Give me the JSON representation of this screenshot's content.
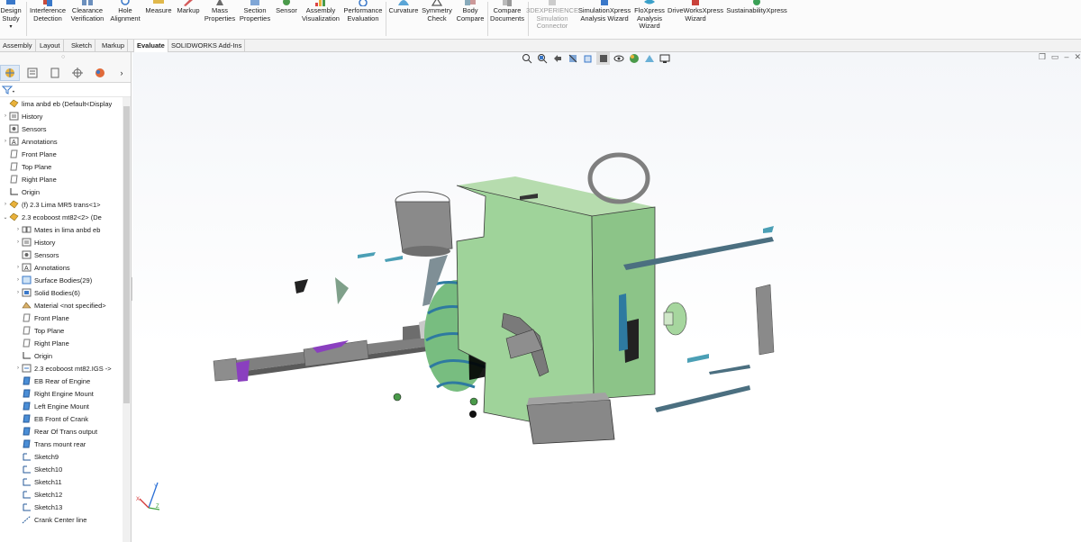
{
  "ribbon": {
    "buttons": [
      {
        "label": "Design\nStudy",
        "icon": "design-study-icon"
      },
      {
        "label": "Interference\nDetection",
        "icon": "interference-detection-icon"
      },
      {
        "label": "Clearance\nVerification",
        "icon": "clearance-verification-icon"
      },
      {
        "label": "Hole\nAlignment",
        "icon": "hole-alignment-icon"
      },
      {
        "label": "Measure",
        "icon": "measure-icon"
      },
      {
        "label": "Markup",
        "icon": "markup-icon"
      },
      {
        "label": "Mass\nProperties",
        "icon": "mass-properties-icon"
      },
      {
        "label": "Section\nProperties",
        "icon": "section-properties-icon"
      },
      {
        "label": "Sensor",
        "icon": "sensor-icon"
      },
      {
        "label": "Assembly\nVisualization",
        "icon": "assembly-visualization-icon"
      },
      {
        "label": "Performance\nEvaluation",
        "icon": "performance-evaluation-icon"
      },
      {
        "label": "Curvature",
        "icon": "curvature-icon"
      },
      {
        "label": "Symmetry\nCheck",
        "icon": "symmetry-check-icon"
      },
      {
        "label": "Body\nCompare",
        "icon": "body-compare-icon"
      },
      {
        "label": "Compare\nDocuments",
        "icon": "compare-documents-icon"
      },
      {
        "label": "3DEXPERIENCE\nSimulation\nConnector",
        "icon": "3dexperience-icon"
      },
      {
        "label": "SimulationXpress\nAnalysis Wizard",
        "icon": "simulationxpress-icon"
      },
      {
        "label": "FloXpress\nAnalysis\nWizard",
        "icon": "floxpress-icon"
      },
      {
        "label": "DriveWorksXpress\nWizard",
        "icon": "driveworksxpress-icon"
      },
      {
        "label": "SustainabilityXpress",
        "icon": "sustainabilityxpress-icon"
      }
    ]
  },
  "tabs": [
    "Assembly",
    "Layout",
    "Sketch",
    "Markup",
    "Evaluate",
    "SOLIDWORKS Add-Ins"
  ],
  "active_tab": "Evaluate",
  "tree": {
    "root": "lima anbd eb  (Default<Display",
    "items": [
      {
        "label": "History",
        "icon": "history-icon"
      },
      {
        "label": "Sensors",
        "icon": "sensors-icon"
      },
      {
        "label": "Annotations",
        "icon": "annotations-icon"
      },
      {
        "label": "Front Plane",
        "icon": "plane-icon"
      },
      {
        "label": "Top Plane",
        "icon": "plane-icon"
      },
      {
        "label": "Right Plane",
        "icon": "plane-icon"
      },
      {
        "label": "Origin",
        "icon": "origin-icon"
      },
      {
        "label": "(f) 2.3 Lima MR5 trans<1>",
        "icon": "part-icon"
      },
      {
        "label": "2.3 ecoboost mt82<2> (De",
        "icon": "part-icon"
      },
      {
        "label": "Mates in lima anbd eb",
        "icon": "mates-icon"
      },
      {
        "label": "History",
        "icon": "history-icon"
      },
      {
        "label": "Sensors",
        "icon": "sensors-icon"
      },
      {
        "label": "Annotations",
        "icon": "annotations-icon"
      },
      {
        "label": "Surface Bodies(29)",
        "icon": "surface-bodies-icon"
      },
      {
        "label": "Solid Bodies(6)",
        "icon": "solid-bodies-icon"
      },
      {
        "label": "Material <not specified>",
        "icon": "material-icon"
      },
      {
        "label": "Front Plane",
        "icon": "plane-icon"
      },
      {
        "label": "Top Plane",
        "icon": "plane-icon"
      },
      {
        "label": "Right Plane",
        "icon": "plane-icon"
      },
      {
        "label": "Origin",
        "icon": "origin-icon"
      },
      {
        "label": "2.3 ecoboost mt82.IGS ->",
        "icon": "import-icon"
      },
      {
        "label": "EB Rear of Engine",
        "icon": "ref-plane-icon"
      },
      {
        "label": "Right Engine Mount",
        "icon": "ref-plane-icon"
      },
      {
        "label": "Left Engine Mount",
        "icon": "ref-plane-icon"
      },
      {
        "label": "EB Front of Crank",
        "icon": "ref-plane-icon"
      },
      {
        "label": "Rear Of Trans output",
        "icon": "ref-plane-icon"
      },
      {
        "label": "Trans mount rear",
        "icon": "ref-plane-icon"
      },
      {
        "label": "Sketch9",
        "icon": "sketch-icon"
      },
      {
        "label": "Sketch10",
        "icon": "sketch-icon"
      },
      {
        "label": "Sketch11",
        "icon": "sketch-icon"
      },
      {
        "label": "Sketch12",
        "icon": "sketch-icon"
      },
      {
        "label": "Sketch13",
        "icon": "sketch-icon"
      },
      {
        "label": "Crank Center line",
        "icon": "line-icon"
      }
    ]
  },
  "colors": {
    "accent": "#2a6fd6",
    "part_green": "#9fd39a",
    "part_gray": "#8c8c8c",
    "part_teal": "#4b9fb5",
    "part_purple": "#8a3fbf"
  }
}
